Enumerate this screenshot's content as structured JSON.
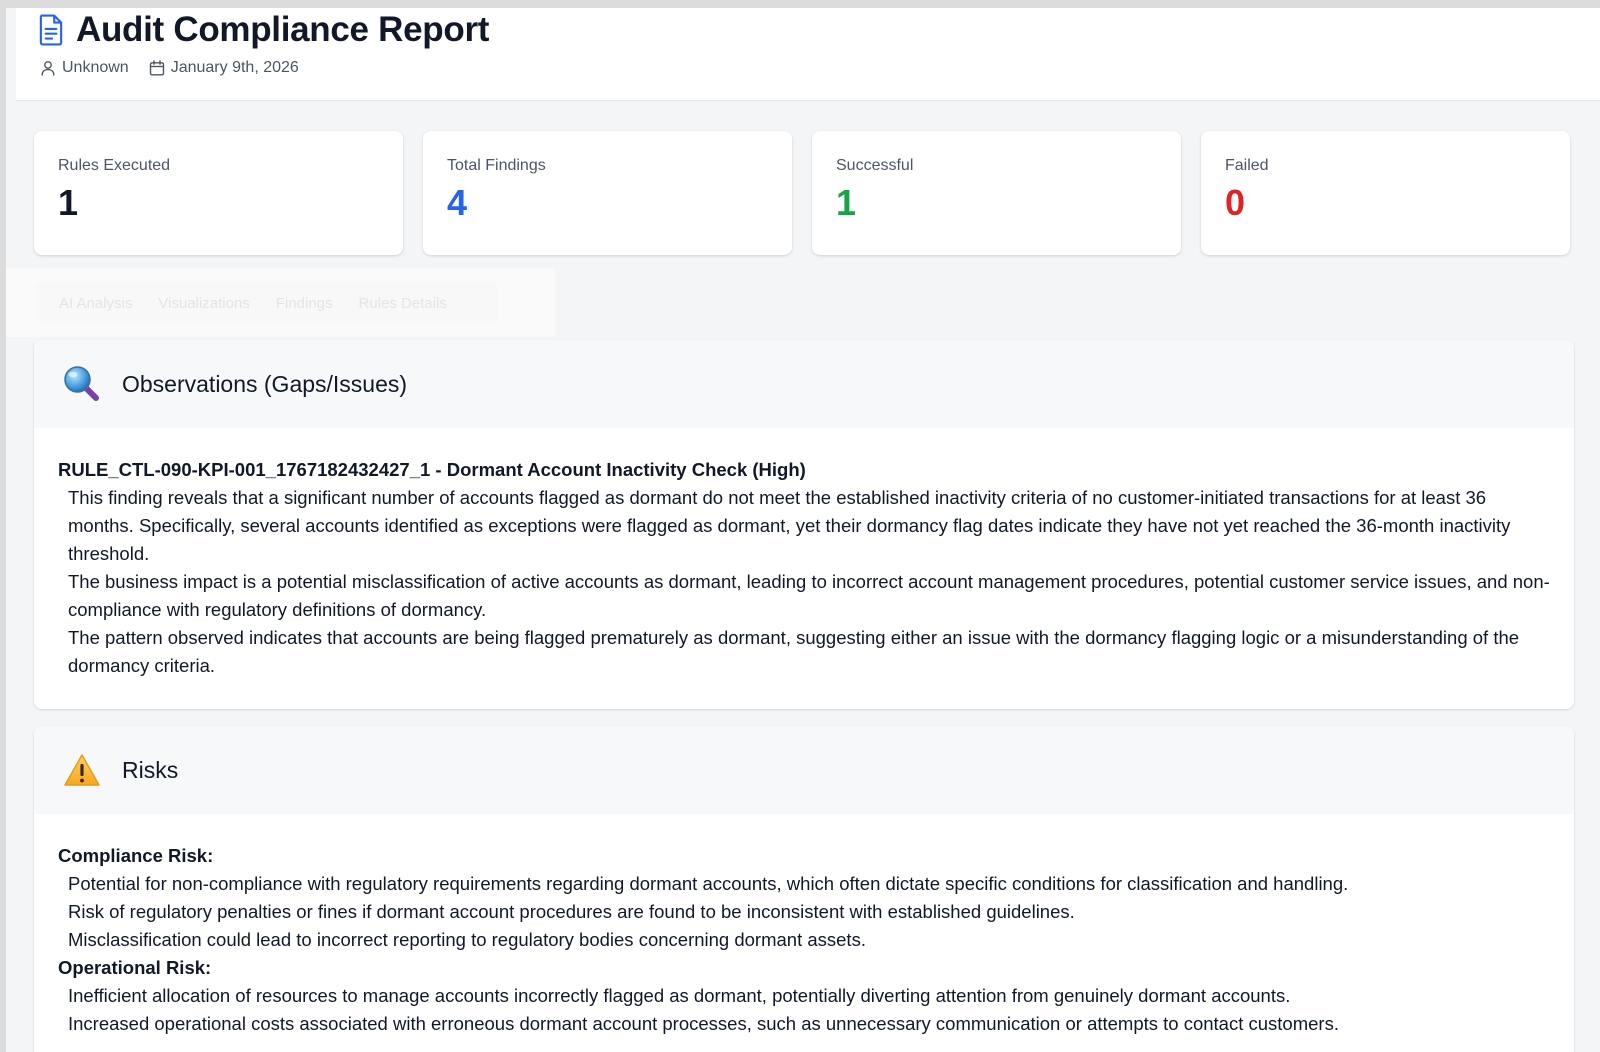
{
  "header": {
    "title": "Audit Compliance Report",
    "author": "Unknown",
    "date": "January 9th, 2026",
    "icons": {
      "title": "document-icon",
      "author": "user-icon",
      "date": "calendar-icon"
    }
  },
  "stats": [
    {
      "label": "Rules Executed",
      "value": "1",
      "color": "#111827"
    },
    {
      "label": "Total Findings",
      "value": "4",
      "color": "#2563eb"
    },
    {
      "label": "Successful",
      "value": "1",
      "color": "#16a34a"
    },
    {
      "label": "Failed",
      "value": "0",
      "color": "#dc2626"
    }
  ],
  "tabs": [
    {
      "label": "AI Analysis"
    },
    {
      "label": "Visualizations"
    },
    {
      "label": "Findings"
    },
    {
      "label": "Rules Details"
    }
  ],
  "observations": {
    "title": "Observations (Gaps/Issues)",
    "icon": "magnifying-glass-icon",
    "finding_title": "RULE_CTL-090-KPI-001_1767182432427_1 - Dormant Account Inactivity Check (High)",
    "paragraphs": [
      "This finding reveals that a significant number of accounts flagged as dormant do not meet the established inactivity criteria of no customer-initiated transactions for at least 36 months. Specifically, several accounts identified as exceptions were flagged as dormant, yet their dormancy flag dates indicate they have not yet reached the 36-month inactivity threshold.",
      "The business impact is a potential misclassification of active accounts as dormant, leading to incorrect account management procedures, potential customer service issues, and non-compliance with regulatory definitions of dormancy.",
      "The pattern observed indicates that accounts are being flagged prematurely as dormant, suggesting either an issue with the dormancy flagging logic or a misunderstanding of the dormancy criteria."
    ]
  },
  "risks": {
    "title": "Risks",
    "icon": "warning-icon",
    "compliance": {
      "heading": "Compliance Risk:",
      "items": [
        "Potential for non-compliance with regulatory requirements regarding dormant accounts, which often dictate specific conditions for classification and handling.",
        "Risk of regulatory penalties or fines if dormant account procedures are found to be inconsistent with established guidelines.",
        "Misclassification could lead to incorrect reporting to regulatory bodies concerning dormant assets."
      ]
    },
    "operational": {
      "heading": "Operational Risk:",
      "items": [
        "Inefficient allocation of resources to manage accounts incorrectly flagged as dormant, potentially diverting attention from genuinely dormant accounts.",
        "Increased operational costs associated with erroneous dormant account processes, such as unnecessary communication or attempts to contact customers."
      ]
    }
  }
}
